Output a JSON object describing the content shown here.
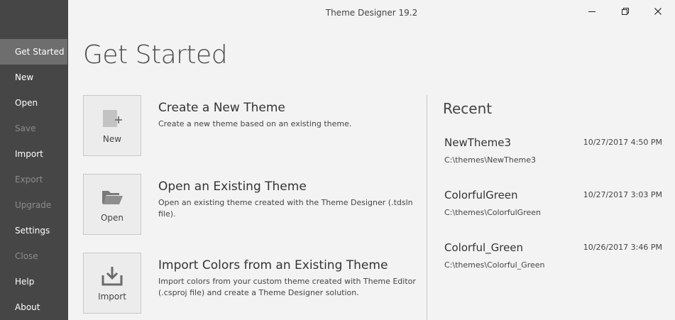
{
  "window": {
    "title": "Theme Designer 19.2"
  },
  "sidebar": {
    "items": [
      {
        "label": "Get Started",
        "state": "active"
      },
      {
        "label": "New",
        "state": "enabled"
      },
      {
        "label": "Open",
        "state": "enabled"
      },
      {
        "label": "Save",
        "state": "disabled"
      },
      {
        "label": "Import",
        "state": "enabled"
      },
      {
        "label": "Export",
        "state": "disabled"
      },
      {
        "label": "Upgrade",
        "state": "disabled"
      },
      {
        "label": "Settings",
        "state": "enabled"
      },
      {
        "label": "Close",
        "state": "disabled"
      },
      {
        "label": "Help",
        "state": "enabled"
      },
      {
        "label": "About",
        "state": "enabled"
      }
    ]
  },
  "main": {
    "title": "Get Started",
    "actions": [
      {
        "tile_label": "New",
        "icon": "new-document-icon",
        "title": "Create a New Theme",
        "description": "Create a new theme based on an existing theme."
      },
      {
        "tile_label": "Open",
        "icon": "folder-open-icon",
        "title": "Open an Existing Theme",
        "description": "Open an existing theme created with the Theme Designer (.tdsln file)."
      },
      {
        "tile_label": "Import",
        "icon": "import-icon",
        "title": "Import Colors from an Existing Theme",
        "description_line1": "Import colors from your custom theme created with Theme Editor",
        "description_line2": "(.csproj file) and create a Theme Designer solution."
      }
    ]
  },
  "recent": {
    "heading": "Recent",
    "items": [
      {
        "name": "NewTheme3",
        "date": "10/27/2017 4:50 PM",
        "path": "C:\\themes\\NewTheme3"
      },
      {
        "name": "ColorfulGreen",
        "date": "10/27/2017 3:03 PM",
        "path": "C:\\themes\\ColorfulGreen"
      },
      {
        "name": "Colorful_Green",
        "date": "10/26/2017 3:46 PM",
        "path": "C:\\themes\\Colorful_Green"
      }
    ]
  },
  "colors": {
    "sidebar_bg": "#464646",
    "sidebar_active_bg": "#6e6e6e",
    "sidebar_disabled_text": "#8c8c8c",
    "content_bg": "#f3f3f3"
  }
}
